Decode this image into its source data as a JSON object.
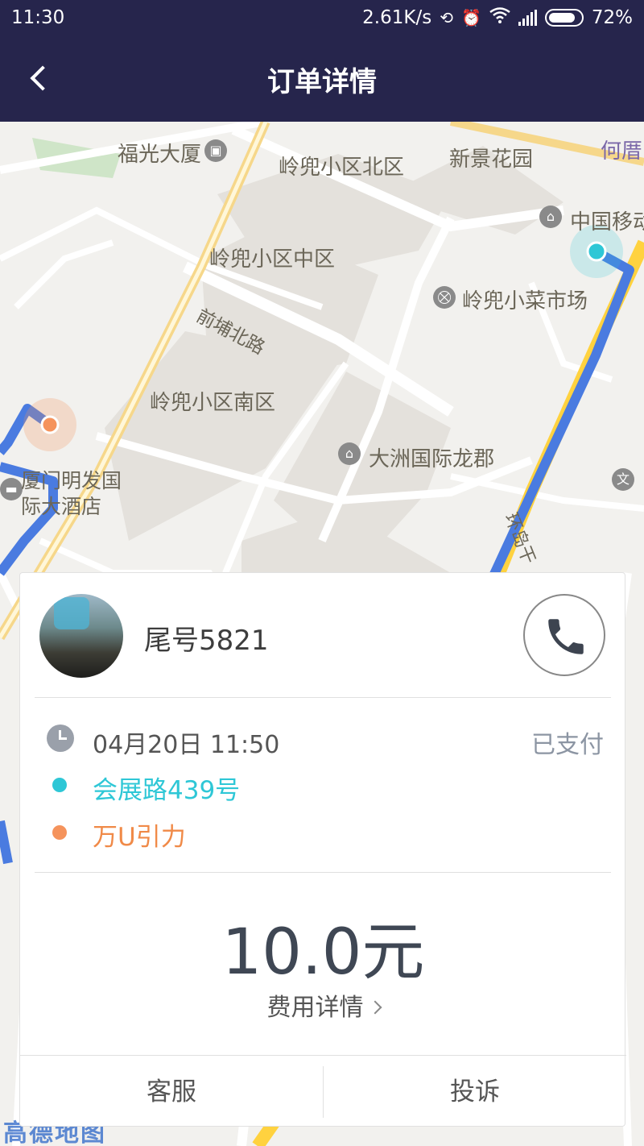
{
  "status_bar": {
    "time": "11:30",
    "network_speed": "2.61K/s",
    "battery": "72%",
    "icons": [
      "sync-icon",
      "alarm-icon",
      "wifi-icon",
      "signal-icon",
      "battery-icon"
    ]
  },
  "nav": {
    "title": "订单详情",
    "back_icon": "chevron-left-icon"
  },
  "map": {
    "labels": {
      "fuguang": "福光大厦",
      "lingdou_north": "岭兜小区北区",
      "xinjing": "新景花园",
      "hecuo": "何厝",
      "china_mobile": "中国移动",
      "lingdou_mid": "岭兜小区中区",
      "qianpu_north_rd": "前埔北路",
      "market": "岭兜小菜市场",
      "lingdou_south": "岭兜小区南区",
      "dazhou": "大洲国际龙郡",
      "mingfa_line1": "厦门明发国",
      "mingfa_line2": "际大酒店",
      "huandao": "环岛干",
      "amap_logo": "高德地图"
    },
    "colors": {
      "route": "#4a7be0",
      "arterial": "#ffd23f",
      "start": "#2ec7d6",
      "end": "#f5935c"
    }
  },
  "order": {
    "driver": "尾号5821",
    "time": "04月20日 11:50",
    "pay_status": "已支付",
    "start": "会展路439号",
    "end": "万U引力",
    "fare": "10.0元",
    "fare_detail": "费用详情",
    "customer_service": "客服",
    "complaint": "投诉"
  }
}
